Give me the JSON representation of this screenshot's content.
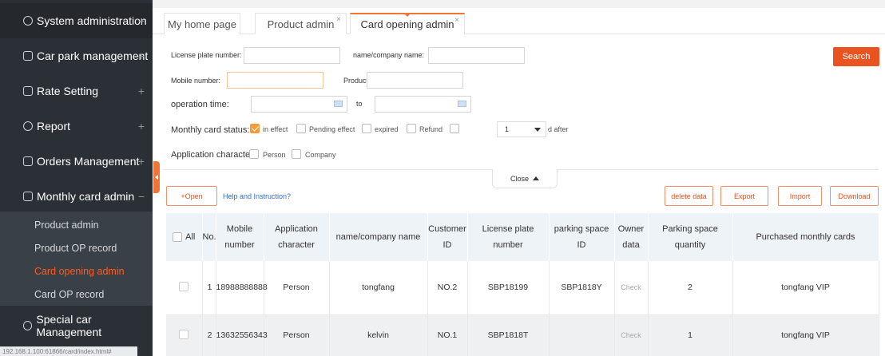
{
  "sidebar": {
    "items": [
      {
        "label": "System administration",
        "icon": "gear-icon",
        "toggle": "+"
      },
      {
        "label": "Car park management",
        "icon": "car-icon",
        "toggle": "+"
      },
      {
        "label": "Rate Setting",
        "icon": "table-icon",
        "toggle": "+"
      },
      {
        "label": "Report",
        "icon": "pie-chart-icon",
        "toggle": "+"
      },
      {
        "label": "Orders Management",
        "icon": "orders-icon",
        "toggle": "+"
      },
      {
        "label": "Monthly card admin",
        "icon": "card-icon",
        "toggle": "−"
      },
      {
        "label": "Special car Management",
        "icon": "gear-icon",
        "toggle": ""
      }
    ],
    "subitems": [
      {
        "label": "Product admin"
      },
      {
        "label": "Product OP record"
      },
      {
        "label": "Card opening admin"
      },
      {
        "label": "Card OP record"
      }
    ]
  },
  "statusbar": "192.168.1.100:61866/card/index.html#",
  "tabs": [
    {
      "label": "My home page"
    },
    {
      "label": "Product admin",
      "close": "×"
    },
    {
      "label": "Card opening admin",
      "close": "×"
    }
  ],
  "form": {
    "license_label": "License plate number:",
    "name_label": "name/company name:",
    "search_label": "Search",
    "mobile_label": "Mobile number:",
    "product_label": "Product:",
    "optime_label": "operation time:",
    "to_label": "to",
    "status_label": "Monthly card status:",
    "status_options": [
      "in effect",
      "Pending effect",
      "expired",
      "Refund"
    ],
    "days_value": "1",
    "days_after": "d after",
    "appchar_label": "Application character:",
    "appchar_options": [
      "Person",
      "Company"
    ],
    "close_label": "Close"
  },
  "actions": {
    "open": "+Open",
    "help": "Help and Instruction?",
    "delete": "delete data",
    "export": "Export",
    "import": "Import",
    "download": "Download"
  },
  "table": {
    "headers": {
      "all": "All",
      "no": "No.",
      "mobile": "Mobile number",
      "appchar": "Application character",
      "name": "name/company name",
      "customer": "Customer ID",
      "plate": "License plate number",
      "space": "parking space ID",
      "owner": "Owner data",
      "qty": "Parking space quantity",
      "purchased": "Purchased monthly cards"
    },
    "rows": [
      {
        "no": "1",
        "mobile": "18988888888",
        "appchar": "Person",
        "name": "tongfang",
        "customer": "NO.2",
        "plate": "SBP18199",
        "space": "SBP1818Y",
        "owner": "Check",
        "qty": "2",
        "purchased": "tongfang VIP"
      },
      {
        "no": "2",
        "mobile": "13632556343",
        "appchar": "Person",
        "name": "kelvin",
        "customer": "NO.1",
        "plate": "SBP1818T",
        "space": "",
        "owner": "Check",
        "qty": "1",
        "purchased": "tongfang VIP"
      }
    ]
  },
  "colors": {
    "accent": "#e8531f",
    "sidebar": "#2b3036",
    "table_header": "#eef3f7"
  }
}
